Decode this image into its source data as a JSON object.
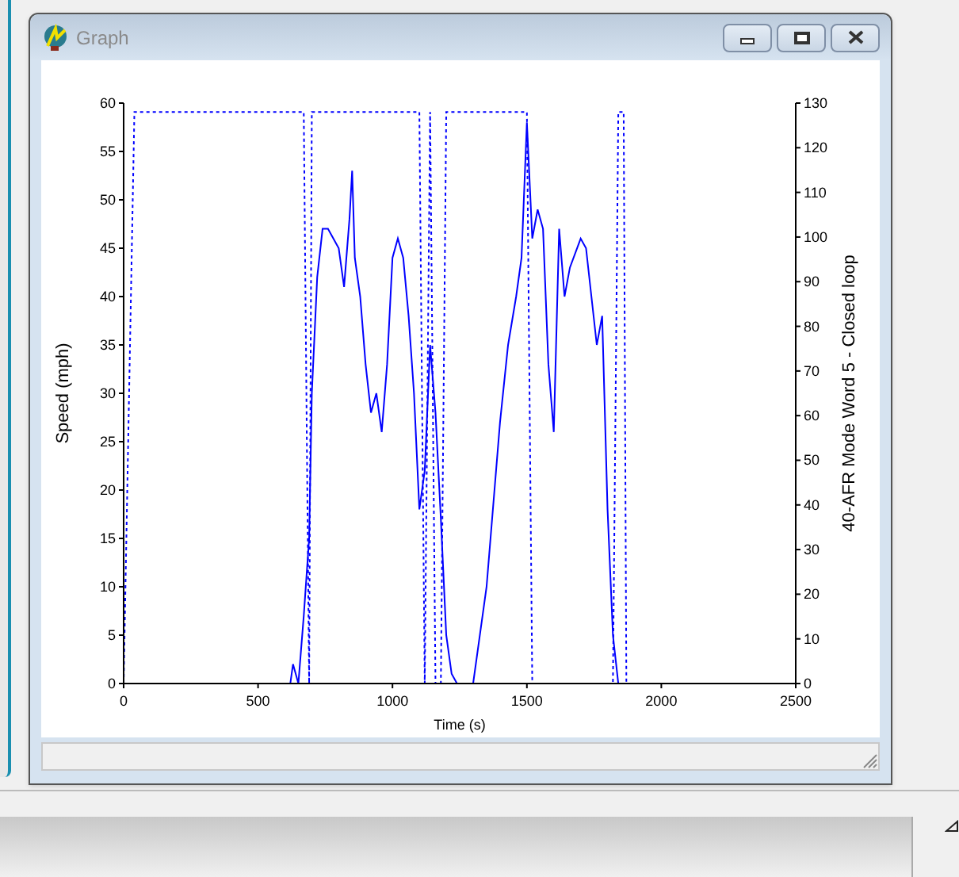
{
  "window": {
    "title": "Graph",
    "active": false
  },
  "graph": {
    "chart_data": {
      "type": "line",
      "xlabel": "Time (s)",
      "ylabel": "Speed (mph)",
      "y2label": "40-AFR Mode Word 5 - Closed loop",
      "xlim": [
        0,
        2500
      ],
      "ylim": [
        0,
        60
      ],
      "y2lim": [
        0,
        130
      ],
      "xticks": [
        0,
        500,
        1000,
        1500,
        2000,
        2500
      ],
      "yticks": [
        0,
        5,
        10,
        15,
        20,
        25,
        30,
        35,
        40,
        45,
        50,
        55,
        60
      ],
      "y2ticks": [
        0,
        10,
        20,
        30,
        40,
        50,
        60,
        70,
        80,
        90,
        100,
        110,
        120,
        130
      ],
      "x": [
        0,
        40,
        620,
        630,
        650,
        670,
        690,
        700,
        720,
        740,
        760,
        780,
        800,
        820,
        840,
        850,
        860,
        880,
        900,
        920,
        940,
        960,
        980,
        1000,
        1020,
        1040,
        1060,
        1080,
        1100,
        1120,
        1140,
        1160,
        1180,
        1200,
        1220,
        1240,
        1300,
        1350,
        1400,
        1430,
        1460,
        1480,
        1500,
        1520,
        1540,
        1560,
        1580,
        1600,
        1620,
        1640,
        1660,
        1700,
        1720,
        1740,
        1760,
        1780,
        1800,
        1820,
        1840,
        1860,
        1870,
        2200
      ],
      "series": [
        {
          "color": "#0000ff",
          "values": [
            0,
            0,
            0,
            2,
            0,
            7,
            15,
            30,
            42,
            47,
            47,
            46,
            45,
            41,
            48,
            53,
            44,
            40,
            33,
            28,
            30,
            26,
            33,
            44,
            46,
            44,
            38,
            30,
            18,
            22,
            35,
            28,
            17,
            5,
            1,
            0,
            0,
            10,
            27,
            35,
            40,
            44,
            58,
            46,
            49,
            47,
            33,
            26,
            47,
            40,
            43,
            46,
            45,
            40,
            35,
            38,
            18,
            5,
            0,
            0,
            null,
            null
          ]
        },
        {
          "color": "#0000ff",
          "axis": "y2",
          "line_style": "dotted",
          "values": [
            0,
            128,
            128,
            128,
            128,
            128,
            0,
            128,
            128,
            128,
            128,
            128,
            128,
            128,
            128,
            128,
            128,
            128,
            128,
            128,
            128,
            128,
            128,
            128,
            128,
            128,
            128,
            128,
            128,
            0,
            128,
            0,
            0,
            128,
            128,
            128,
            128,
            128,
            128,
            128,
            128,
            128,
            128,
            0,
            0,
            0,
            0,
            0,
            0,
            0,
            0,
            0,
            0,
            0,
            0,
            0,
            0,
            0,
            128,
            128,
            0,
            0
          ]
        }
      ]
    }
  }
}
